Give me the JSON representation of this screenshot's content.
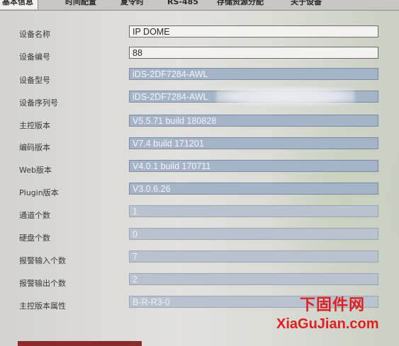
{
  "tabs": [
    "基本信息",
    "时间配置",
    "夏令时",
    "RS-485",
    "存储资源分配",
    "关于设备"
  ],
  "fields": [
    {
      "label": "设备名称",
      "value": "IP DOME",
      "editable": true
    },
    {
      "label": "设备编号",
      "value": "88",
      "editable": true
    },
    {
      "label": "设备型号",
      "value": "iDS-2DF7284-AWL",
      "editable": false
    },
    {
      "label": "设备序列号",
      "value": "iDS-2DF7284-AWL",
      "editable": false
    },
    {
      "label": "主控版本",
      "value": "V5.5.71 build 180828",
      "editable": false
    },
    {
      "label": "编码版本",
      "value": "V7.4 build 171201",
      "editable": false
    },
    {
      "label": "Web版本",
      "value": "V4.0.1 build 170711",
      "editable": false
    },
    {
      "label": "Plugin版本",
      "value": "V3.0.6.26",
      "editable": false
    },
    {
      "label": "通道个数",
      "value": "1",
      "editable": false
    },
    {
      "label": "硬盘个数",
      "value": "0",
      "editable": false
    },
    {
      "label": "报警输入个数",
      "value": "7",
      "editable": false
    },
    {
      "label": "报警输出个数",
      "value": "2",
      "editable": false
    },
    {
      "label": "主控版本属性",
      "value": "B-R-R3-0",
      "editable": false
    }
  ],
  "watermark": {
    "chinese": "下固件网",
    "english": "XiaGuJian.com",
    "color": "#e02020"
  },
  "colors": {
    "readonly_field": "#a6b4c9",
    "editable_field": "#f3f2ef",
    "accent_bar": "#8c2b2b"
  }
}
